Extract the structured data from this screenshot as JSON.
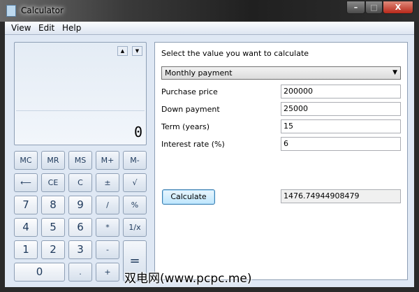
{
  "window": {
    "title": "Calculator",
    "minimize": "–",
    "maximize": "□",
    "close": "X"
  },
  "menu": [
    {
      "label": "View"
    },
    {
      "label": "Edit"
    },
    {
      "label": "Help"
    }
  ],
  "display": {
    "value": "0",
    "up": "▲",
    "down": "▼"
  },
  "keys": [
    [
      "MC",
      "MR",
      "MS",
      "M+",
      "M-"
    ],
    [
      "⟵",
      "CE",
      "C",
      "±",
      "√"
    ],
    [
      "7",
      "8",
      "9",
      "/",
      "%"
    ],
    [
      "4",
      "5",
      "6",
      "*",
      "1/x"
    ],
    [
      "1",
      "2",
      "3",
      "-",
      "="
    ],
    [
      "0",
      ".",
      "+"
    ]
  ],
  "worksheet": {
    "prompt": "Select the value you want to calculate",
    "selected": "Monthly payment",
    "fields": [
      {
        "label": "Purchase price",
        "value": "200000"
      },
      {
        "label": "Down payment",
        "value": "25000"
      },
      {
        "label": "Term (years)",
        "value": "15"
      },
      {
        "label": "Interest rate (%)",
        "value": "6"
      }
    ],
    "calculate": "Calculate",
    "result": "1476.74944908479"
  },
  "watermark": "双电网(www.pcpc.me)"
}
